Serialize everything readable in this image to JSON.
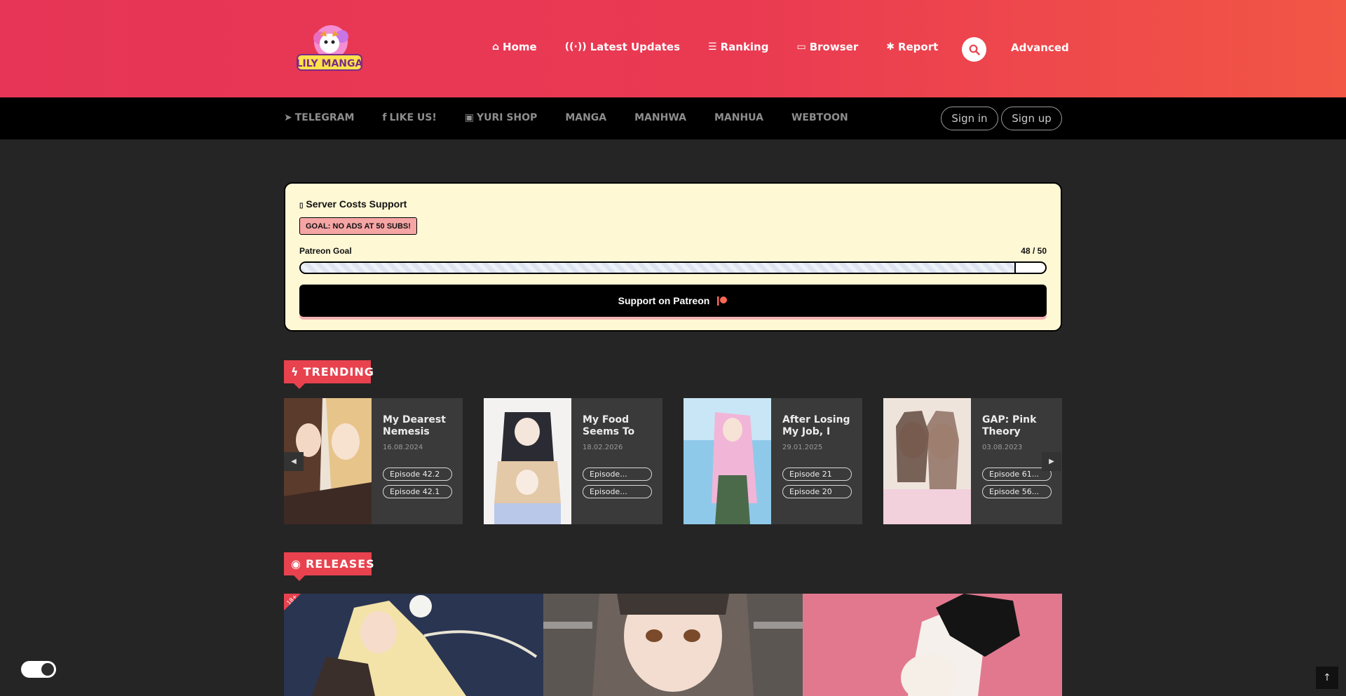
{
  "header": {
    "logo_text": "LILY MANGA",
    "nav": [
      {
        "label": "Home",
        "icon": "home-icon"
      },
      {
        "label": "Latest Updates",
        "icon": "broadcast-icon"
      },
      {
        "label": "Ranking",
        "icon": "list-icon"
      },
      {
        "label": "Browser",
        "icon": "folder-icon"
      },
      {
        "label": "Report",
        "icon": "bug-icon"
      }
    ],
    "advanced_label": "Advanced"
  },
  "subnav": {
    "items": [
      {
        "label": "TELEGRAM",
        "icon": "telegram-icon"
      },
      {
        "label": "LIKE US!",
        "icon": "facebook-icon"
      },
      {
        "label": "YURI SHOP",
        "icon": "shop-icon"
      },
      {
        "label": "MANGA",
        "icon": ""
      },
      {
        "label": "MANHWA",
        "icon": ""
      },
      {
        "label": "MANHUA",
        "icon": ""
      },
      {
        "label": "WEBTOON",
        "icon": ""
      }
    ],
    "signin_label": "Sign in",
    "signup_label": "Sign up"
  },
  "support": {
    "title": "Server Costs Support",
    "badge": "GOAL: NO ADS AT 50 SUBS!",
    "goal_label": "Patreon Goal",
    "goal_count": "48 / 50",
    "progress": 0.96,
    "button_label": "Support on Patreon"
  },
  "trending": {
    "heading": "TRENDING",
    "cards": [
      {
        "title": "My Dearest Nemesis",
        "date": "16.08.2024",
        "ep1": "Episode 42.2",
        "ep2": "Episode 42.1"
      },
      {
        "title": "My Food Seems To B...",
        "date": "18.02.2026",
        "ep1": "Episode...",
        "ep2": "Episode..."
      },
      {
        "title": "After Losing My Job, I Me...",
        "date": "29.01.2025",
        "ep1": "Episode 21",
        "ep2": "Episode 20"
      },
      {
        "title": "GAP: Pink Theory Novel",
        "date": "03.08.2023",
        "ep1": "Episode 61...",
        "ep2": "Episode 56..."
      }
    ]
  },
  "releases": {
    "heading": "RELEASES",
    "badge_18": "18+"
  },
  "colors": {
    "header_start": "#e63556",
    "header_end": "#f25645",
    "accent": "#e8424f",
    "support_bg": "#fff8d5",
    "page_bg": "#252525"
  }
}
